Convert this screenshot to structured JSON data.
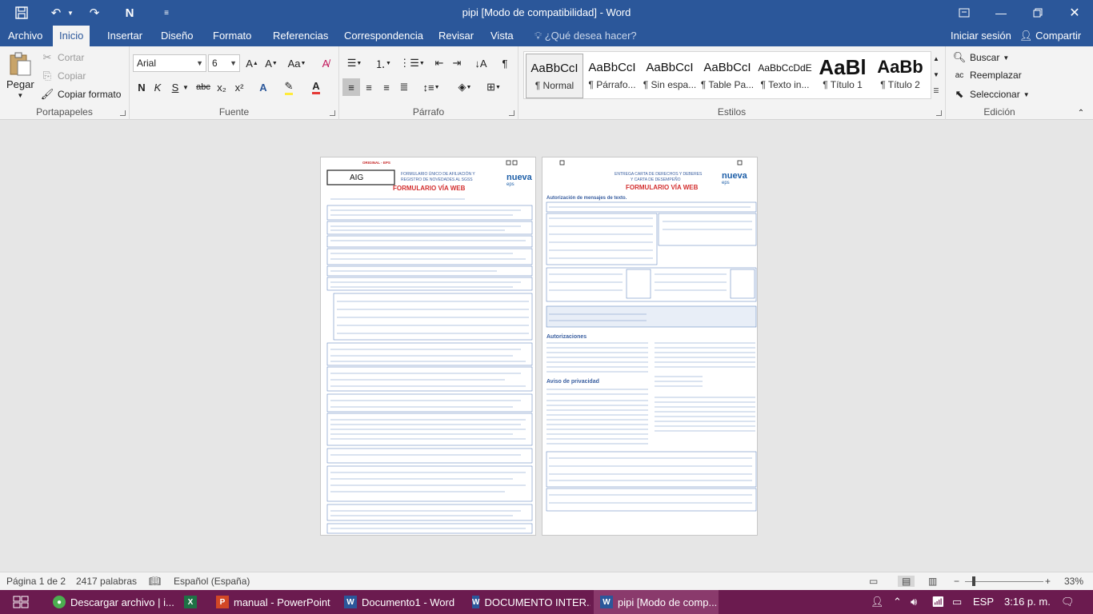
{
  "window": {
    "title": "pipi [Modo de compatibilidad] - Word"
  },
  "quick_access": {
    "redo_label": "N"
  },
  "menu": {
    "tabs": [
      "Archivo",
      "Inicio",
      "Insertar",
      "Diseño",
      "Formato",
      "Referencias",
      "Correspondencia",
      "Revisar",
      "Vista"
    ],
    "active_tab": "Inicio",
    "tell_me": "¿Qué desea hacer?",
    "sign_in": "Iniciar sesión",
    "share": "Compartir"
  },
  "clipboard": {
    "paste": "Pegar",
    "cut": "Cortar",
    "copy": "Copiar",
    "format_painter": "Copiar formato",
    "label": "Portapapeles"
  },
  "font": {
    "name": "Arial",
    "size": "6",
    "label": "Fuente",
    "bold": "N",
    "italic": "K",
    "underline": "S",
    "strike": "abc",
    "sub": "x₂",
    "sup": "x²"
  },
  "paragraph": {
    "label": "Párrafo"
  },
  "styles": {
    "label": "Estilos",
    "items": [
      {
        "preview": "AaBbCcI",
        "name": "¶ Normal"
      },
      {
        "preview": "AaBbCcI",
        "name": "¶ Párrafo..."
      },
      {
        "preview": "AaBbCcI",
        "name": "¶ Sin espa..."
      },
      {
        "preview": "AaBbCcI",
        "name": "¶ Table Pa..."
      },
      {
        "preview": "AaBbCcDdE",
        "name": "¶ Texto in..."
      },
      {
        "preview": "AaBl",
        "name": "¶ Título 1"
      },
      {
        "preview": "AaBb",
        "name": "¶ Título 2"
      }
    ]
  },
  "editing": {
    "find": "Buscar",
    "replace": "Reemplazar",
    "select": "Seleccionar",
    "label": "Edición"
  },
  "document": {
    "page1": {
      "header_left": "ORIGINAL - EPS",
      "title1": "FORMULARIO ÚNICO DE AFILIACIÓN Y",
      "title2": "REGISTRO DE NOVEDADES AL SGSS",
      "web": "FORMULARIO VÍA WEB",
      "logo": "AIG",
      "brand": "nueva",
      "brand_sub": "eps"
    },
    "page2": {
      "title1": "ENTREGA CARTA DE DERECHOS Y DEBERES",
      "title2": "Y CARTA DE DESEMPEÑO",
      "web": "FORMULARIO VÍA WEB",
      "section1": "Autorización de mensajes de texto.",
      "section2": "Autorizaciones",
      "section3": "Aviso de privacidad",
      "brand": "nueva",
      "brand_sub": "eps"
    }
  },
  "status": {
    "page": "Página 1 de 2",
    "words": "2417 palabras",
    "language": "Español (España)",
    "zoom": "33%"
  },
  "zoom_level": 0.33,
  "taskbar": {
    "items": [
      {
        "label": "Descargar archivo | i...",
        "icon": "chrome-icon",
        "color": "#4caf50"
      },
      {
        "label": "",
        "icon": "excel-icon",
        "color": "#1e7145"
      },
      {
        "label": "manual - PowerPoint",
        "icon": "powerpoint-icon",
        "color": "#d24726"
      },
      {
        "label": "Documento1 - Word",
        "icon": "word-icon",
        "color": "#2b579a"
      },
      {
        "label": "DOCUMENTO INTER...",
        "icon": "word-icon",
        "color": "#2b579a"
      },
      {
        "label": "pipi [Modo de comp...",
        "icon": "word-icon",
        "color": "#2b579a"
      }
    ],
    "language": "ESP",
    "time": "3:16 p. m."
  }
}
